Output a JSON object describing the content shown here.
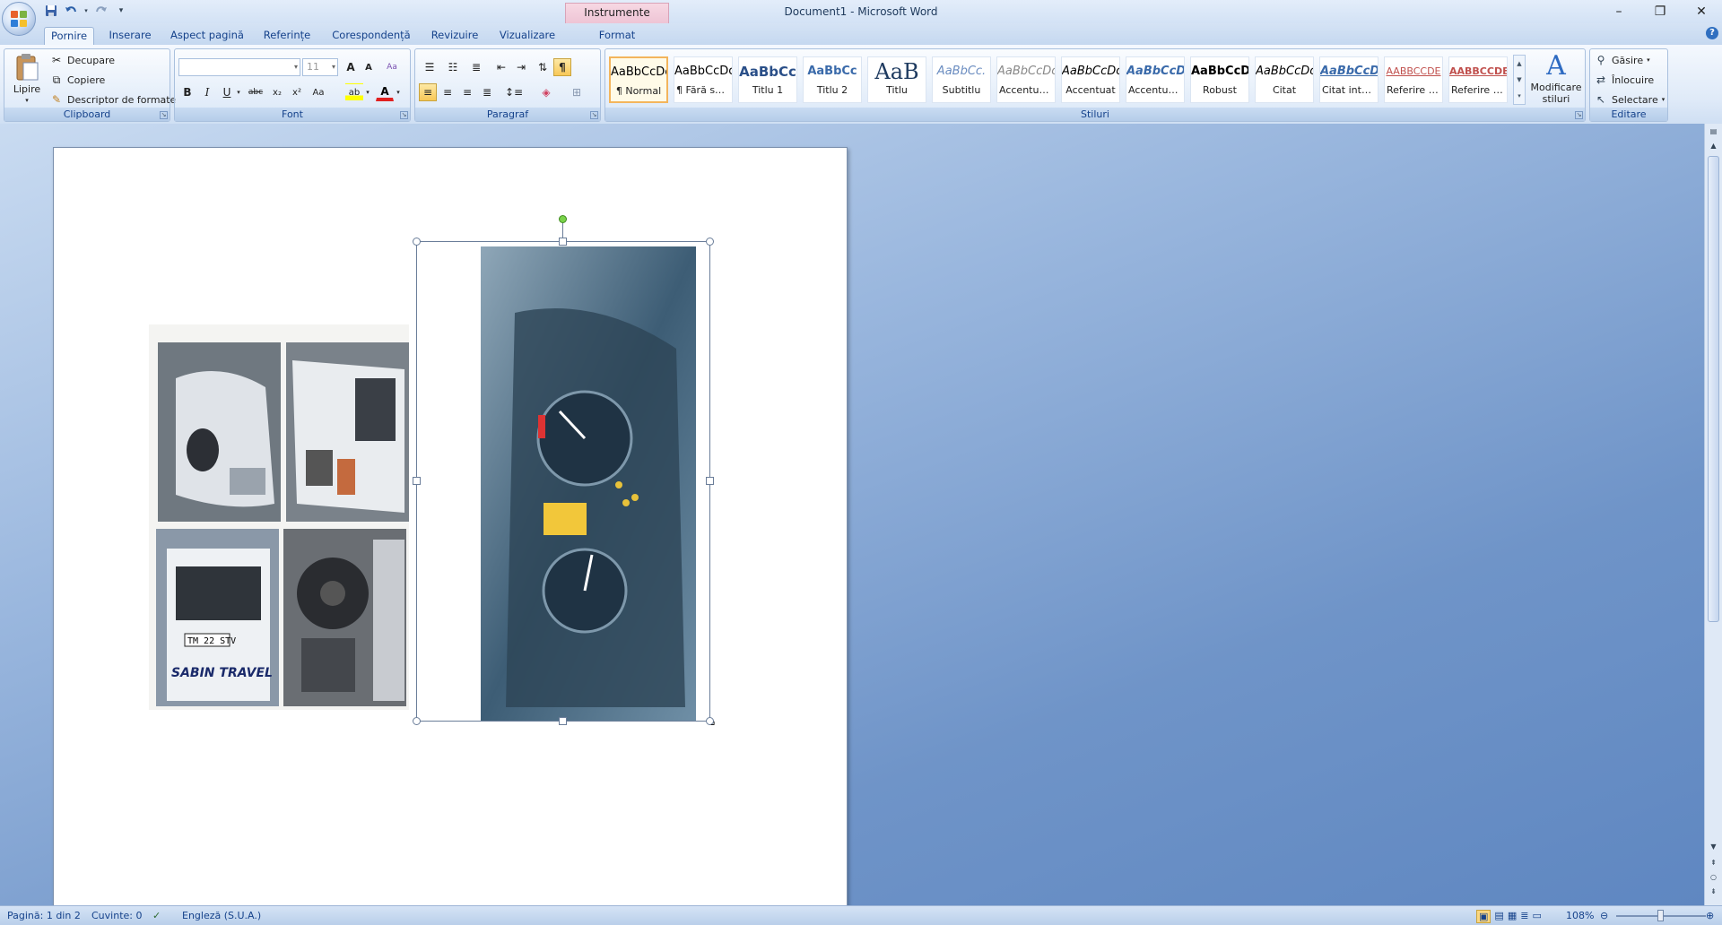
{
  "window": {
    "title": "Document1 - Microsoft Word",
    "contextual_tab": "Instrumente imagine",
    "minimize": "–",
    "restore": "❐",
    "close": "✕"
  },
  "qat": {
    "save": "save-icon",
    "undo": "undo-icon",
    "redo": "redo-icon",
    "customize": "▾"
  },
  "tabs": [
    "Pornire",
    "Inserare",
    "Aspect pagină",
    "Referințe",
    "Corespondență",
    "Revizuire",
    "Vizualizare",
    "Format"
  ],
  "active_tab": "Pornire",
  "help": "?",
  "clipboard": {
    "label": "Clipboard",
    "paste": "Lipire",
    "cut": "Decupare",
    "copy": "Copiere",
    "format_painter": "Descriptor de formate"
  },
  "font": {
    "label": "Font",
    "name": "",
    "size": "11",
    "grow": "A",
    "shrink": "A",
    "clear": "Aa",
    "bold": "B",
    "italic": "I",
    "underline": "U",
    "strike": "abc",
    "subscript": "x₂",
    "superscript": "x²",
    "change_case": "Aa",
    "highlight": "ab",
    "font_color": "A"
  },
  "paragraph": {
    "label": "Paragraf",
    "pilcrow": "¶"
  },
  "styles": {
    "label": "Stiluri",
    "items": [
      {
        "preview": "AaBbCcDc",
        "name": "¶ Normal"
      },
      {
        "preview": "AaBbCcDc",
        "name": "¶ Fără spa..."
      },
      {
        "preview": "AaBbCc",
        "name": "Titlu 1"
      },
      {
        "preview": "AaBbCc",
        "name": "Titlu 2"
      },
      {
        "preview": "AaB",
        "name": "Titlu"
      },
      {
        "preview": "AaBbCc.",
        "name": "Subtitlu"
      },
      {
        "preview": "AaBbCcDc",
        "name": "Accentuar..."
      },
      {
        "preview": "AaBbCcDc",
        "name": "Accentuat"
      },
      {
        "preview": "AaBbCcDc",
        "name": "Accentuar..."
      },
      {
        "preview": "AaBbCcDc",
        "name": "Robust"
      },
      {
        "preview": "AaBbCcDc",
        "name": "Citat"
      },
      {
        "preview": "AaBbCcDc",
        "name": "Citat intens"
      },
      {
        "preview": "AABBCCDE",
        "name": "Referire s..."
      },
      {
        "preview": "AABBCCDE",
        "name": "Referire in..."
      }
    ],
    "change_styles_line1": "Modificare",
    "change_styles_line2": "stiluri"
  },
  "editing": {
    "label": "Editare",
    "find": "Găsire",
    "replace": "Înlocuire",
    "select": "Selectare"
  },
  "document": {
    "plate_text": "TM 22 STV",
    "van_text": "SABIN TRAVEL"
  },
  "status": {
    "page": "Pagină: 1 din 2",
    "words": "Cuvinte: 0",
    "language": "Engleză (S.U.A.)",
    "zoom": "108%",
    "zoom_fraction": 0.5
  }
}
